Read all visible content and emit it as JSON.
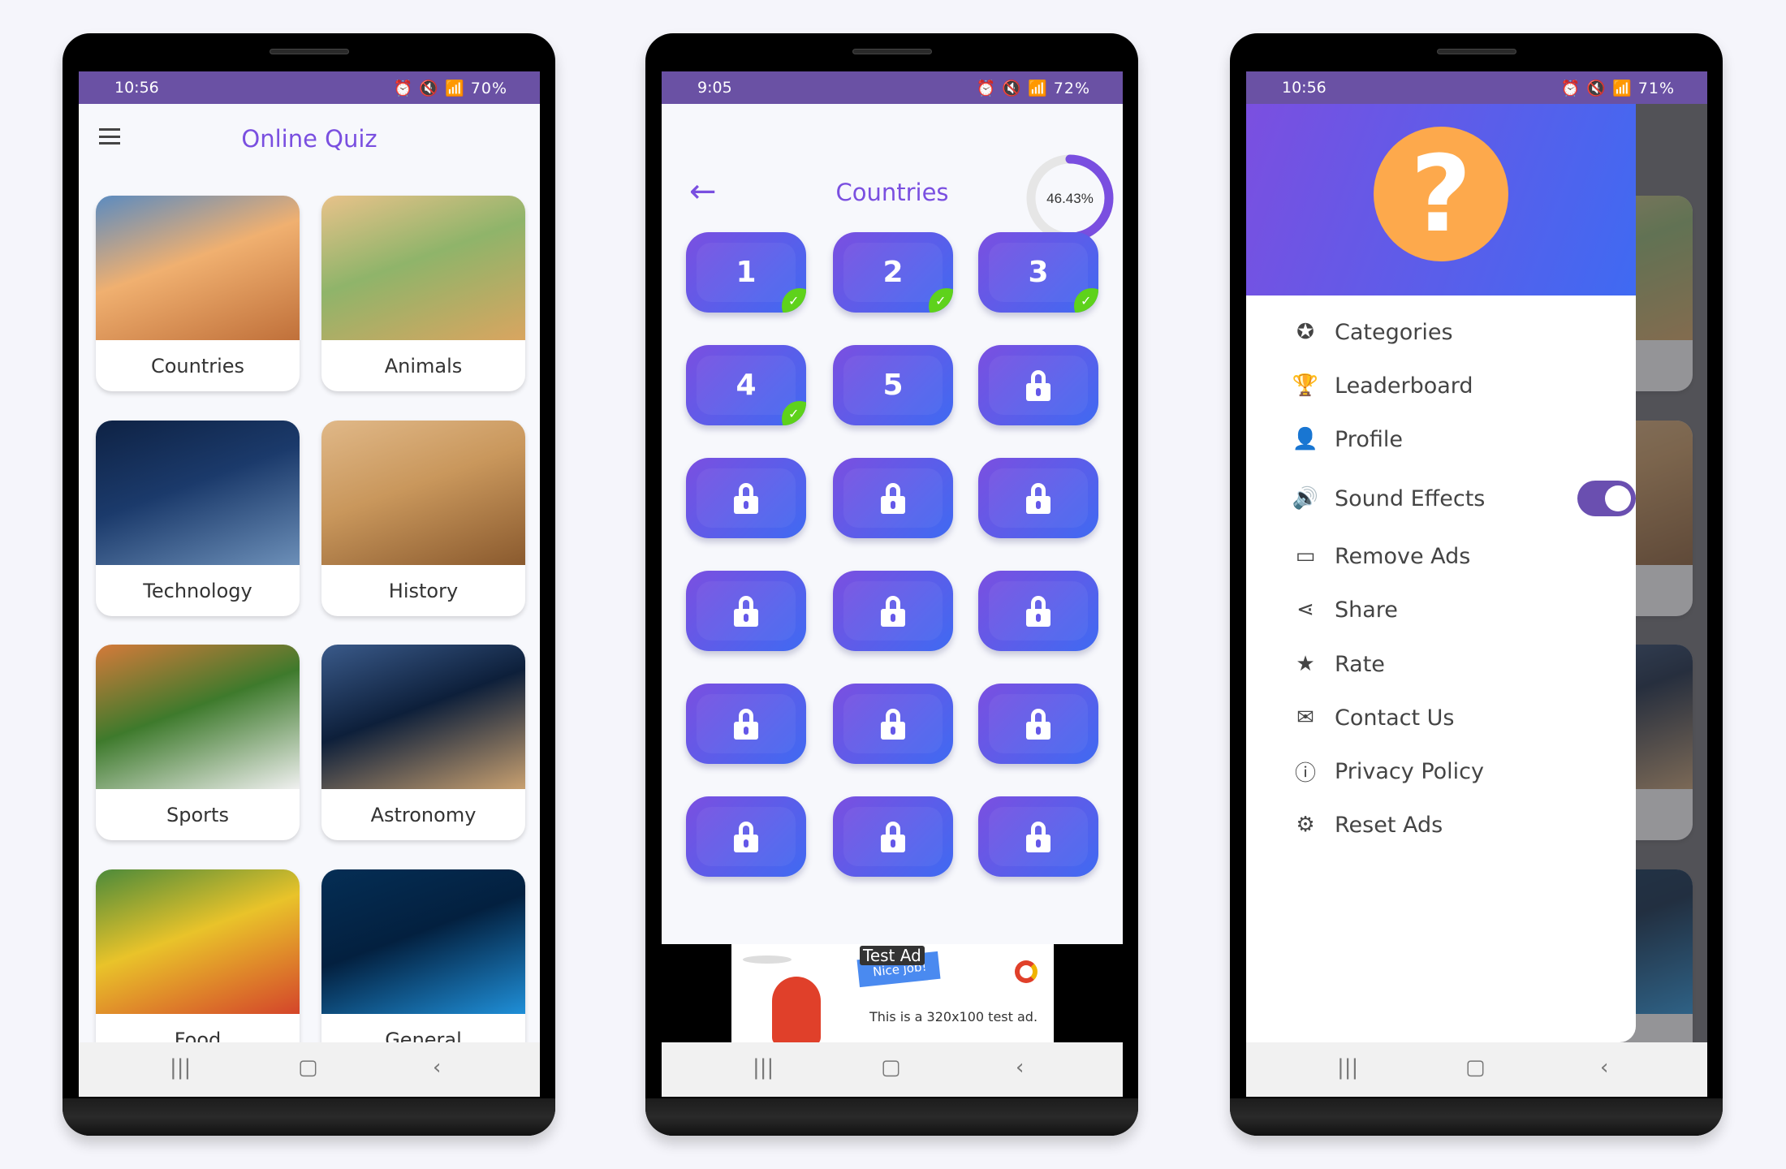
{
  "phones": [
    {
      "status": {
        "time": "10:56",
        "battery": "70%",
        "icons": "⏰ 🔇 📶"
      }
    },
    {
      "status": {
        "time": "9:05",
        "battery": "72%",
        "icons": "⏰ 🔇 📶"
      }
    },
    {
      "status": {
        "time": "10:56",
        "battery": "71%",
        "icons": "⏰ 🔇 📶"
      }
    }
  ],
  "home": {
    "title": "Online Quiz",
    "menu_icon": "hamburger-icon",
    "categories": [
      {
        "label": "Countries",
        "colors": [
          "#f0b070",
          "#c0703a",
          "#5b8bc0"
        ]
      },
      {
        "label": "Animals",
        "colors": [
          "#8fb46a",
          "#d9a560",
          "#e8c28a"
        ]
      },
      {
        "label": "Technology",
        "colors": [
          "#1b3a6b",
          "#6c8fb8",
          "#0e2244"
        ]
      },
      {
        "label": "History",
        "colors": [
          "#c9975c",
          "#8a5a2e",
          "#e0b888"
        ]
      },
      {
        "label": "Sports",
        "colors": [
          "#3e7a2c",
          "#f0f0f0",
          "#d57a3a"
        ]
      },
      {
        "label": "Astronomy",
        "colors": [
          "#0d1f3a",
          "#c8a070",
          "#3a5a8a"
        ]
      },
      {
        "label": "Food",
        "colors": [
          "#e9c32a",
          "#d4452a",
          "#4c8a3a"
        ]
      },
      {
        "label": "General",
        "colors": [
          "#03203f",
          "#1f8fd8",
          "#052e55"
        ]
      }
    ]
  },
  "levels": {
    "title": "Countries",
    "progress_label": "46.43%",
    "progress": 46.43,
    "accent": "#7a4fe0",
    "items": [
      {
        "label": "1",
        "state": "completed"
      },
      {
        "label": "2",
        "state": "completed"
      },
      {
        "label": "3",
        "state": "completed"
      },
      {
        "label": "4",
        "state": "completed"
      },
      {
        "label": "5",
        "state": "unlocked"
      },
      {
        "label": "",
        "state": "locked"
      },
      {
        "label": "",
        "state": "locked"
      },
      {
        "label": "",
        "state": "locked"
      },
      {
        "label": "",
        "state": "locked"
      },
      {
        "label": "",
        "state": "locked"
      },
      {
        "label": "",
        "state": "locked"
      },
      {
        "label": "",
        "state": "locked"
      },
      {
        "label": "",
        "state": "locked"
      },
      {
        "label": "",
        "state": "locked"
      },
      {
        "label": "",
        "state": "locked"
      },
      {
        "label": "",
        "state": "locked"
      },
      {
        "label": "",
        "state": "locked"
      },
      {
        "label": "",
        "state": "locked"
      }
    ],
    "ad": {
      "badge": "Test Ad",
      "banner": "Nice job!",
      "text": "This is a 320x100 test ad."
    }
  },
  "drawer": {
    "items": [
      {
        "label": "Categories",
        "icon": "badge-icon",
        "glyph": "✪"
      },
      {
        "label": "Leaderboard",
        "icon": "trophy-icon",
        "glyph": "🏆"
      },
      {
        "label": "Profile",
        "icon": "person-icon",
        "glyph": "👤"
      },
      {
        "label": "Sound Effects",
        "icon": "speaker-icon",
        "glyph": "🔊",
        "toggle": true
      },
      {
        "label": "Remove Ads",
        "icon": "credit-card-icon",
        "glyph": "▭"
      },
      {
        "label": "Share",
        "icon": "share-icon",
        "glyph": "⋖"
      },
      {
        "label": "Rate",
        "icon": "star-icon",
        "glyph": "★"
      },
      {
        "label": "Contact Us",
        "icon": "mail-icon",
        "glyph": "✉"
      },
      {
        "label": "Privacy Policy",
        "icon": "info-icon",
        "glyph": "ⓘ"
      },
      {
        "label": "Reset Ads",
        "icon": "gear-icon",
        "glyph": "⚙"
      }
    ],
    "sound_effects_on": true
  },
  "navbar": {
    "recents": "|||",
    "home": "▢",
    "back": "‹"
  }
}
